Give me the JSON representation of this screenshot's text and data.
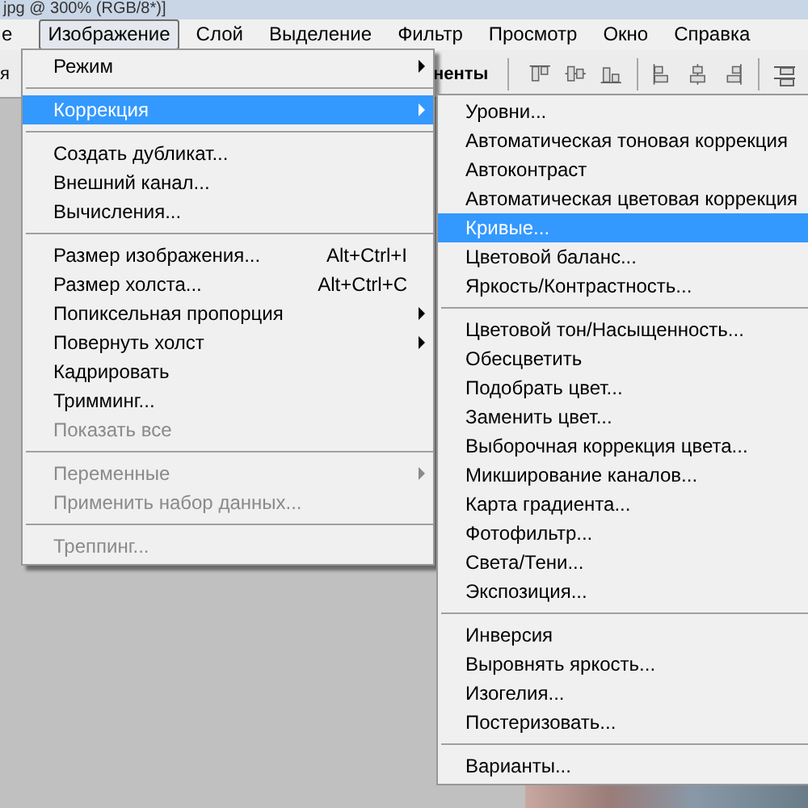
{
  "window": {
    "title": "jpg @ 300% (RGB/8*)]"
  },
  "menubar": [
    {
      "label": "е",
      "selected": false
    },
    {
      "label": "Изображение",
      "selected": true
    },
    {
      "label": "Слой",
      "selected": false
    },
    {
      "label": "Выделение",
      "selected": false
    },
    {
      "label": "Фильтр",
      "selected": false
    },
    {
      "label": "Просмотр",
      "selected": false
    },
    {
      "label": "Окно",
      "selected": false
    },
    {
      "label": "Справка",
      "selected": false
    }
  ],
  "toolbar": {
    "left_text": "я",
    "right_text": "ненты"
  },
  "image_menu": {
    "items": [
      {
        "kind": "item",
        "label": "Режим",
        "submenu": true,
        "disabled": false,
        "selected": false
      },
      {
        "kind": "separator"
      },
      {
        "kind": "item",
        "label": "Коррекция",
        "submenu": true,
        "disabled": false,
        "selected": true
      },
      {
        "kind": "separator"
      },
      {
        "kind": "item",
        "label": "Создать дубликат...",
        "submenu": false,
        "disabled": false,
        "selected": false
      },
      {
        "kind": "item",
        "label": "Внешний канал...",
        "submenu": false,
        "disabled": false,
        "selected": false
      },
      {
        "kind": "item",
        "label": "Вычисления...",
        "submenu": false,
        "disabled": false,
        "selected": false
      },
      {
        "kind": "separator"
      },
      {
        "kind": "item",
        "label": "Размер изображения...",
        "shortcut": "Alt+Ctrl+I",
        "submenu": false,
        "disabled": false,
        "selected": false
      },
      {
        "kind": "item",
        "label": "Размер холста...",
        "shortcut": "Alt+Ctrl+C",
        "submenu": false,
        "disabled": false,
        "selected": false
      },
      {
        "kind": "item",
        "label": "Попиксельная пропорция",
        "submenu": true,
        "disabled": false,
        "selected": false
      },
      {
        "kind": "item",
        "label": "Повернуть холст",
        "submenu": true,
        "disabled": false,
        "selected": false
      },
      {
        "kind": "item",
        "label": "Кадрировать",
        "submenu": false,
        "disabled": false,
        "selected": false
      },
      {
        "kind": "item",
        "label": "Тримминг...",
        "submenu": false,
        "disabled": false,
        "selected": false
      },
      {
        "kind": "item",
        "label": "Показать все",
        "submenu": false,
        "disabled": true,
        "selected": false
      },
      {
        "kind": "separator"
      },
      {
        "kind": "item",
        "label": "Переменные",
        "submenu": true,
        "disabled": true,
        "selected": false
      },
      {
        "kind": "item",
        "label": "Применить набор данных...",
        "submenu": false,
        "disabled": true,
        "selected": false
      },
      {
        "kind": "separator"
      },
      {
        "kind": "item",
        "label": "Треппинг...",
        "submenu": false,
        "disabled": true,
        "selected": false
      }
    ]
  },
  "adjustments_menu": {
    "items": [
      {
        "kind": "item",
        "label": "Уровни...",
        "submenu": false,
        "disabled": false,
        "selected": false
      },
      {
        "kind": "item",
        "label": "Автоматическая тоновая коррекция",
        "submenu": false,
        "disabled": false,
        "selected": false
      },
      {
        "kind": "item",
        "label": "Автоконтраст",
        "submenu": false,
        "disabled": false,
        "selected": false
      },
      {
        "kind": "item",
        "label": "Автоматическая цветовая коррекция",
        "submenu": false,
        "disabled": false,
        "selected": false
      },
      {
        "kind": "item",
        "label": "Кривые...",
        "submenu": false,
        "disabled": false,
        "selected": true
      },
      {
        "kind": "item",
        "label": "Цветовой баланс...",
        "submenu": false,
        "disabled": false,
        "selected": false
      },
      {
        "kind": "item",
        "label": "Яркость/Контрастность...",
        "submenu": false,
        "disabled": false,
        "selected": false
      },
      {
        "kind": "separator"
      },
      {
        "kind": "item",
        "label": "Цветовой тон/Насыщенность...",
        "submenu": false,
        "disabled": false,
        "selected": false
      },
      {
        "kind": "item",
        "label": "Обесцветить",
        "submenu": false,
        "disabled": false,
        "selected": false
      },
      {
        "kind": "item",
        "label": "Подобрать цвет...",
        "submenu": false,
        "disabled": false,
        "selected": false
      },
      {
        "kind": "item",
        "label": "Заменить цвет...",
        "submenu": false,
        "disabled": false,
        "selected": false
      },
      {
        "kind": "item",
        "label": "Выборочная коррекция цвета...",
        "submenu": false,
        "disabled": false,
        "selected": false
      },
      {
        "kind": "item",
        "label": "Микширование каналов...",
        "submenu": false,
        "disabled": false,
        "selected": false
      },
      {
        "kind": "item",
        "label": "Карта градиента...",
        "submenu": false,
        "disabled": false,
        "selected": false
      },
      {
        "kind": "item",
        "label": "Фотофильтр...",
        "submenu": false,
        "disabled": false,
        "selected": false
      },
      {
        "kind": "item",
        "label": "Света/Тени...",
        "submenu": false,
        "disabled": false,
        "selected": false
      },
      {
        "kind": "item",
        "label": "Экспозиция...",
        "submenu": false,
        "disabled": false,
        "selected": false
      },
      {
        "kind": "separator"
      },
      {
        "kind": "item",
        "label": "Инверсия",
        "submenu": false,
        "disabled": false,
        "selected": false
      },
      {
        "kind": "item",
        "label": "Выровнять яркость...",
        "submenu": false,
        "disabled": false,
        "selected": false
      },
      {
        "kind": "item",
        "label": "Изогелия...",
        "submenu": false,
        "disabled": false,
        "selected": false
      },
      {
        "kind": "item",
        "label": "Постеризовать...",
        "submenu": false,
        "disabled": false,
        "selected": false
      },
      {
        "kind": "separator"
      },
      {
        "kind": "item",
        "label": "Варианты...",
        "submenu": false,
        "disabled": false,
        "selected": false
      }
    ]
  }
}
